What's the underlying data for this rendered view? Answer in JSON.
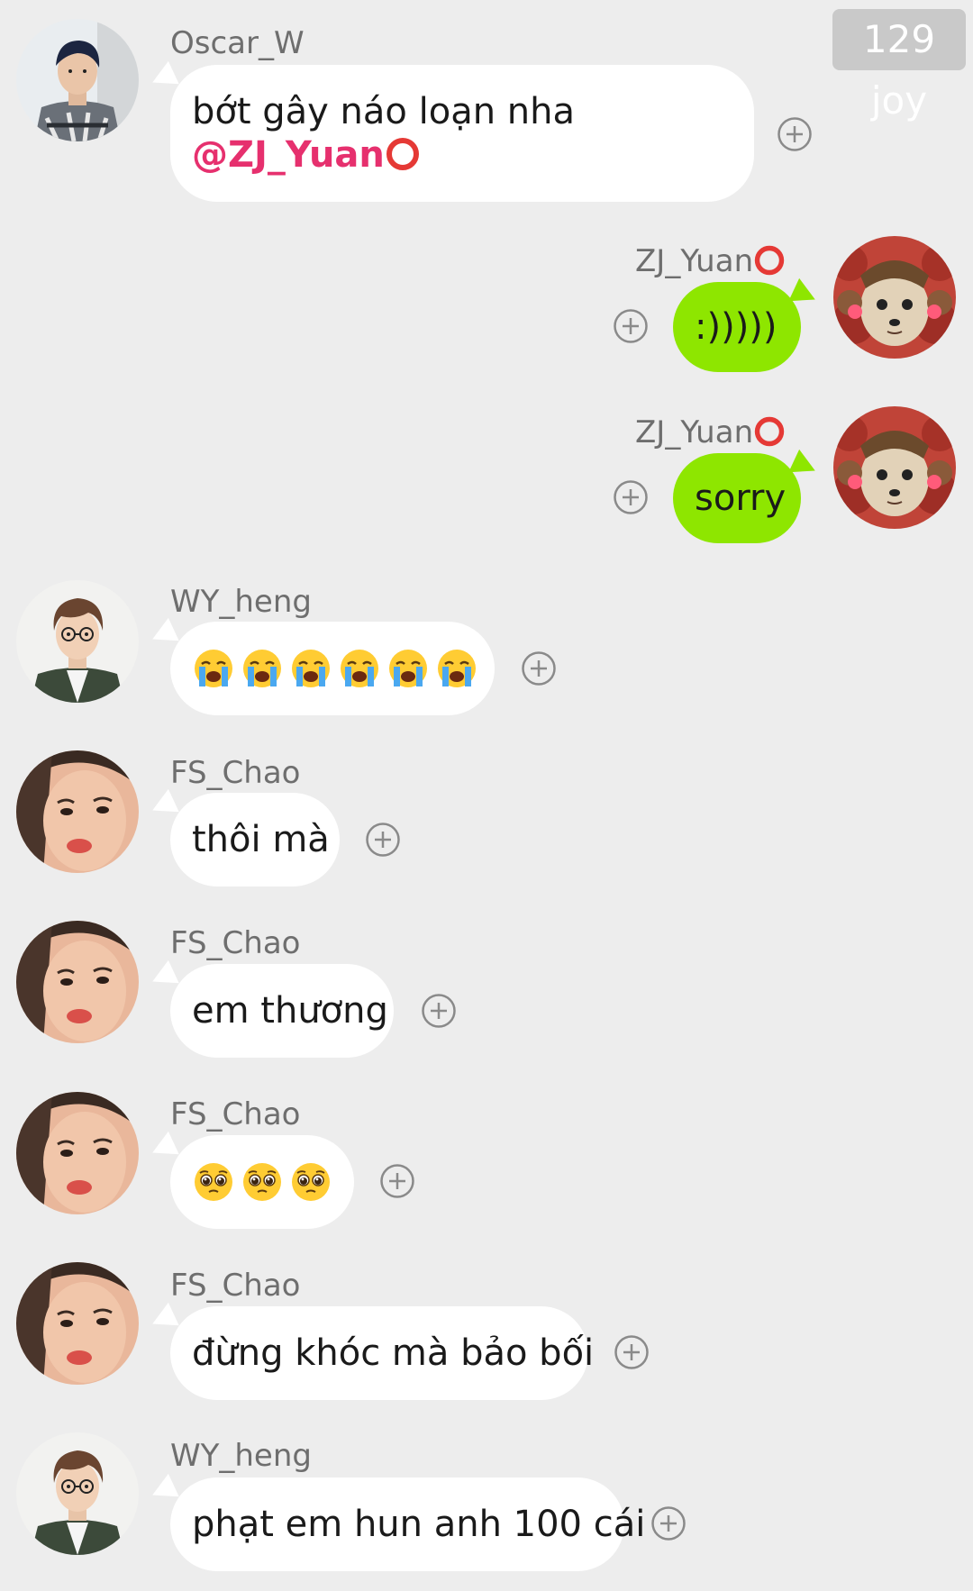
{
  "badge": "129 joy",
  "colors": {
    "background": "#ededed",
    "incoming_bubble": "#ffffff",
    "outgoing_bubble": "#8ee600",
    "mention": "#e6306e",
    "status_ring": "#e53935"
  },
  "messages": [
    {
      "sender": "Oscar_W",
      "text_line1": "bớt gây náo loạn nha",
      "mention": "@ZJ_Yuan"
    },
    {
      "sender": "ZJ_Yuan",
      "text": ":)))))"
    },
    {
      "sender": "ZJ_Yuan",
      "text": "sorry"
    },
    {
      "sender": "WY_heng",
      "emoji": "loudly-crying-face",
      "emoji_count": 6
    },
    {
      "sender": "FS_Chao",
      "text": "thôi mà"
    },
    {
      "sender": "FS_Chao",
      "text": "em thương"
    },
    {
      "sender": "FS_Chao",
      "emoji": "pleading-face",
      "emoji_count": 3
    },
    {
      "sender": "FS_Chao",
      "text": "đừng khóc mà bảo bối"
    },
    {
      "sender": "WY_heng",
      "text": "phạt em hun anh 100 cái"
    }
  ],
  "icons": {
    "add_reaction": "plus-circle-icon",
    "status_ring": "red-ring-icon"
  }
}
